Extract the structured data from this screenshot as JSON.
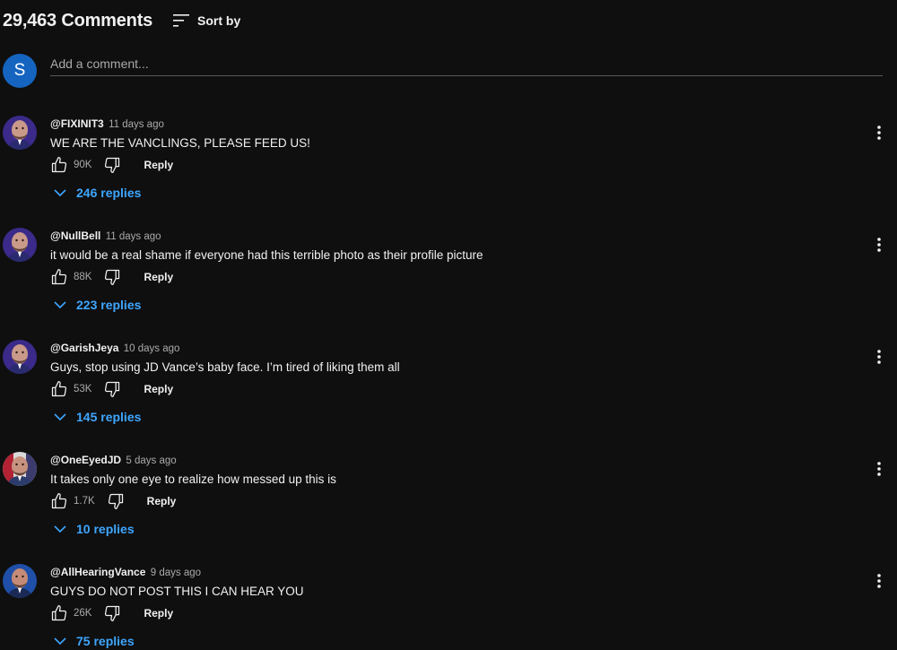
{
  "header": {
    "comment_count": "29,463 Comments",
    "sort_label": "Sort by"
  },
  "add_comment": {
    "avatar_initial": "S",
    "placeholder": "Add a comment...",
    "avatar_color": "#1565c0"
  },
  "comments": [
    {
      "author": "@FIXINIT3",
      "time": "11 days ago",
      "text": "WE ARE THE VANCLINGS, PLEASE FEED US!",
      "likes": "90K",
      "reply_label": "Reply",
      "replies": "246 replies",
      "avatar": "face-avatar-purple"
    },
    {
      "author": "@NullBell",
      "time": "11 days ago",
      "text": "it would be a real shame if everyone had this terrible photo as their profile picture",
      "likes": "88K",
      "reply_label": "Reply",
      "replies": "223 replies",
      "avatar": "face-avatar-purple"
    },
    {
      "author": "@GarishJeya",
      "time": "10 days ago",
      "text": "Guys, stop using JD Vance’s baby face. I’m tired of liking them all",
      "likes": "53K",
      "reply_label": "Reply",
      "replies": "145 replies",
      "avatar": "face-avatar-purple"
    },
    {
      "author": "@OneEyedJD",
      "time": "5 days ago",
      "text": "It takes only one eye to realize how messed up this is",
      "likes": "1.7K",
      "reply_label": "Reply",
      "replies": "10 replies",
      "avatar": "face-avatar-flag"
    },
    {
      "author": "@AllHearingVance",
      "time": "9 days ago",
      "text": "GUYS DO NOT POST THIS I CAN HEAR YOU",
      "likes": "26K",
      "reply_label": "Reply",
      "replies": "75 replies",
      "avatar": "face-avatar-blue"
    }
  ],
  "colors": {
    "background": "#0f0f0f",
    "link_blue": "#3ea6ff",
    "secondary_text": "#aaaaaa"
  }
}
